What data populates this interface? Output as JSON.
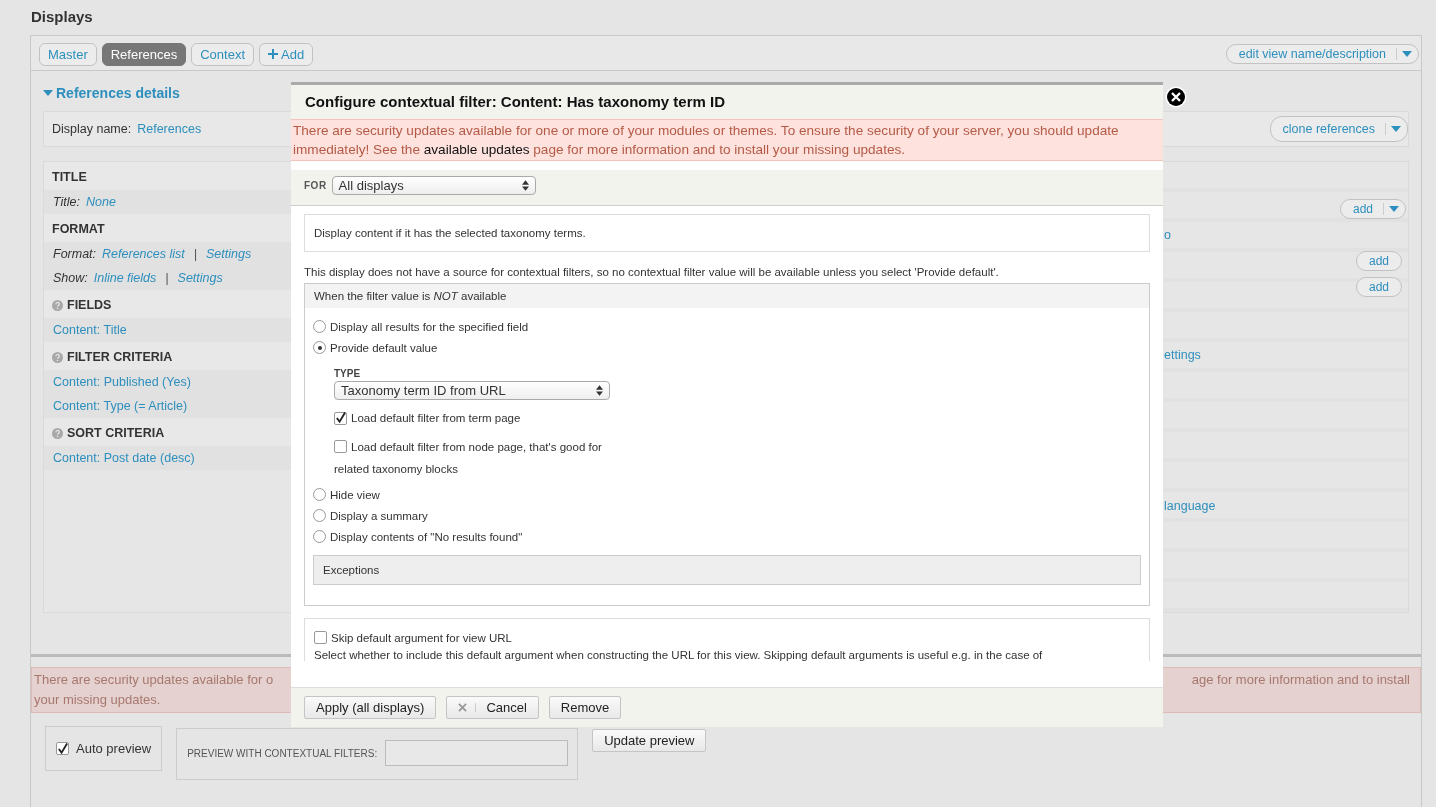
{
  "heading": "Displays",
  "display_tabs": [
    {
      "label": "Master",
      "kind": "display",
      "selected": false
    },
    {
      "label": "References",
      "kind": "display",
      "selected": true
    },
    {
      "label": "Context",
      "kind": "display",
      "selected": false
    },
    {
      "label": "Add",
      "kind": "add",
      "selected": false
    }
  ],
  "edit_button": {
    "label": "edit view name/description"
  },
  "details": {
    "title": "References details",
    "expanded": true,
    "display_name_label": "Display name:",
    "display_name": "References",
    "clone_button": "clone references"
  },
  "sections": [
    {
      "title": "TITLE",
      "help": false,
      "rows": [
        {
          "label": "Title:",
          "links": [
            "None"
          ],
          "separator": ""
        }
      ]
    },
    {
      "title": "FORMAT",
      "help": false,
      "rows": [
        {
          "label": "Format:",
          "links": [
            "References list",
            "Settings"
          ],
          "separator": "|"
        },
        {
          "label": "Show:",
          "links": [
            "Inline fields",
            "Settings"
          ],
          "separator": "|"
        }
      ]
    },
    {
      "title": "FIELDS",
      "help": true,
      "rows": [
        {
          "links": [
            "Content: Title"
          ]
        }
      ]
    },
    {
      "title": "FILTER CRITERIA",
      "help": true,
      "rows": [
        {
          "links": [
            "Content: Published (Yes)"
          ]
        },
        {
          "links": [
            "Content: Type (= Article)"
          ]
        }
      ]
    },
    {
      "title": "SORT CRITERIA",
      "help": true,
      "rows": [
        {
          "links": [
            "Content: Post date (desc)"
          ]
        }
      ]
    }
  ],
  "right_column": [
    {
      "kind": "split",
      "label": "add"
    },
    {
      "kind": "link",
      "text": "o"
    },
    {
      "kind": "button",
      "label": "add"
    },
    {
      "kind": "button",
      "label": "add"
    },
    {
      "kind": "link",
      "text": "ettings"
    },
    {
      "kind": "link",
      "text": "language"
    }
  ],
  "modal": {
    "title": "Configure contextual filter: Content: Has taxonomy term ID",
    "message_before": "There are security updates available for one or more of your modules or themes. To ensure the security of your server, you should update immediately! See the ",
    "message_link": "available updates",
    "message_after": " page for more information and to install your missing updates.",
    "for_label": "FOR",
    "for_select": "All displays",
    "description": "Display content if it has the selected taxonomy terms.",
    "note": "This display does not have a source for contextual filters, so no contextual filter value will be available unless you select 'Provide default'.",
    "legend": "When the filter value is *NOT* available",
    "options": [
      {
        "label": "Display all results for the specified field",
        "selected": false
      },
      {
        "label": "Provide default value",
        "selected": true
      },
      {
        "label": "Hide view",
        "selected": false
      },
      {
        "label": "Display a summary",
        "selected": false
      },
      {
        "label": "Display contents of \"No results found\"",
        "selected": false
      }
    ],
    "type_label": "TYPE",
    "type_select": "Taxonomy term ID from URL",
    "default_checkboxes": [
      {
        "label": "Load default filter from term page",
        "checked": true
      },
      {
        "label": "Load default filter from node page, that's good for related taxonomy blocks",
        "checked": false
      }
    ],
    "exceptions": "Exceptions",
    "skip": {
      "label": "Skip default argument for view URL",
      "checked": false,
      "help": "Select whether to include this default argument when constructing the URL for this view. Skipping default arguments is useful e.g. in the case of"
    },
    "buttons": [
      {
        "label": "Apply (all displays)",
        "kind": "apply"
      },
      {
        "label": "Cancel",
        "kind": "cancel"
      },
      {
        "label": "Remove",
        "kind": "plain"
      }
    ]
  },
  "bottom": {
    "message_left": [
      "There are security updates available for o",
      "your missing updates."
    ],
    "message_right": "age for more information and to install",
    "auto_preview": {
      "label": "Auto preview",
      "checked": true
    },
    "preview_filters_label": "PREVIEW WITH CONTEXTUAL FILTERS:",
    "update_button": "Update preview"
  }
}
